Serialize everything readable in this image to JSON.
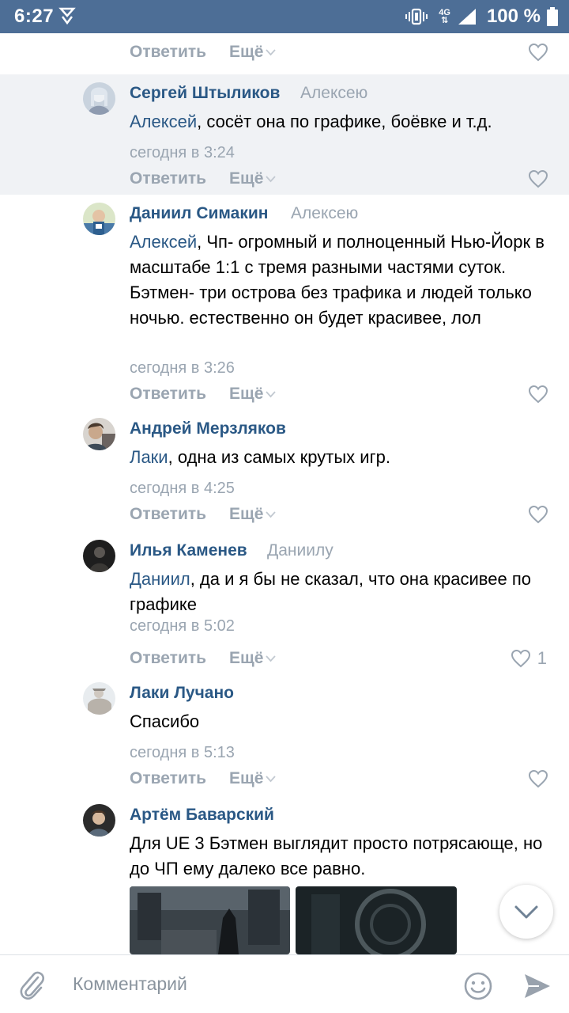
{
  "status_bar": {
    "time": "6:27",
    "network_label": "4G",
    "battery_text": "100 %"
  },
  "top_actions": {
    "reply_label": "Ответить",
    "more_label": "Ещё"
  },
  "comments": [
    {
      "author": "Сергей Штыликов",
      "reply_to": "Алексею",
      "mention": "Алексей",
      "text": ", сосёт она по графике, боёвке и т.д.",
      "time": "сегодня в 3:24",
      "reply_label": "Ответить",
      "more_label": "Ещё",
      "likes": "",
      "highlighted": true
    },
    {
      "author": "Даниил Симакин",
      "reply_to": "Алексею",
      "mention": "Алексей",
      "text": ", Чп- огромный и полноценный Нью-Йорк в масштабе 1:1 с тремя разными частями суток. Бэтмен- три острова без трафика и людей только ночью. естественно он будет красивее, лол",
      "time": "сегодня в 3:26",
      "reply_label": "Ответить",
      "more_label": "Ещё",
      "likes": ""
    },
    {
      "author": "Андрей Мерзляков",
      "reply_to": "",
      "mention": "Лаки",
      "text": ", одна из самых крутых игр.",
      "time": "сегодня в 4:25",
      "reply_label": "Ответить",
      "more_label": "Ещё",
      "likes": ""
    },
    {
      "author": "Илья Каменев",
      "reply_to": "Даниилу",
      "mention": "Даниил",
      "text": ", да и я бы не сказал, что она красивее по графике",
      "time": "сегодня в 5:02",
      "reply_label": "Ответить",
      "more_label": "Ещё",
      "likes": "1"
    },
    {
      "author": "Лаки Лучано",
      "reply_to": "",
      "mention": "",
      "text": "Спасибо",
      "time": "сегодня в 5:13",
      "reply_label": "Ответить",
      "more_label": "Ещё",
      "likes": ""
    },
    {
      "author": "Артём Баварский",
      "reply_to": "",
      "mention": "",
      "text": "Для UE 3 Бэтмен выглядит просто потрясающе, но до ЧП ему далеко все равно.",
      "time": "",
      "reply_label": "",
      "more_label": "",
      "likes": ""
    }
  ],
  "composer": {
    "placeholder": "Комментарий"
  },
  "colors": {
    "status_bar": "#4d6e96",
    "link": "#2a5885",
    "muted": "#9aa5b1",
    "highlight_bg": "#f0f2f5"
  },
  "icons": {
    "like": "heart-outline-icon",
    "more": "chevron-down-icon",
    "attach": "paperclip-icon",
    "emoji": "smiley-icon",
    "send": "send-arrow-icon",
    "scroll": "chevron-down-icon"
  }
}
